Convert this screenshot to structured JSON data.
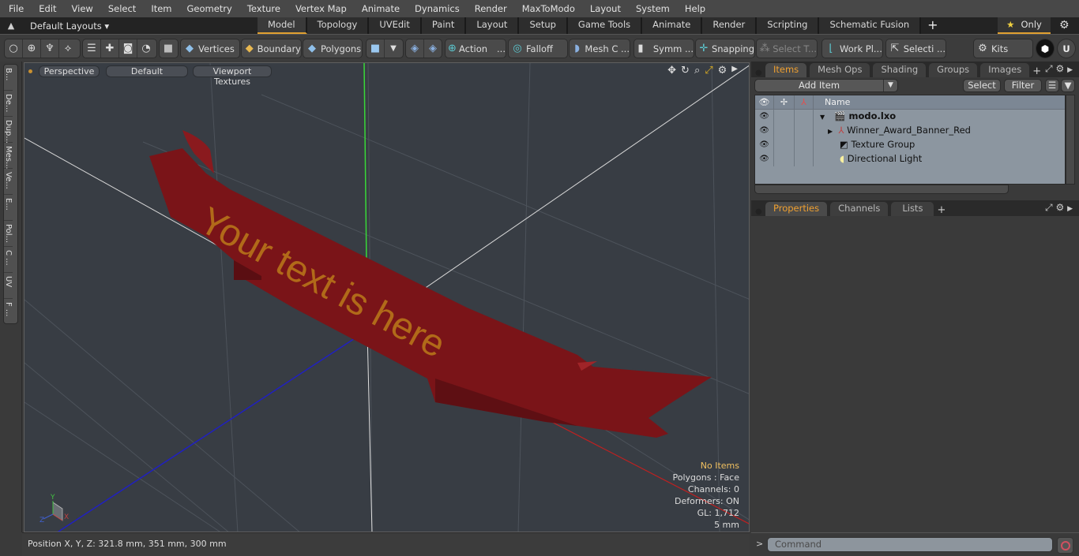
{
  "menu": [
    "File",
    "Edit",
    "View",
    "Select",
    "Item",
    "Geometry",
    "Texture",
    "Vertex Map",
    "Animate",
    "Dynamics",
    "Render",
    "MaxToModo",
    "Layout",
    "System",
    "Help"
  ],
  "layoutbar": {
    "layouts_label": "Default Layouts",
    "tabs": [
      "Model",
      "Topology",
      "UVEdit",
      "Paint",
      "Layout",
      "Setup",
      "Game Tools",
      "Animate",
      "Render",
      "Scripting",
      "Schematic Fusion"
    ],
    "active_tab": "Model",
    "only_label": "Only"
  },
  "toolbar": {
    "vertices": "Vertices",
    "boundary": "Boundary",
    "polygons": "Polygons",
    "action": "Action",
    "falloff": "Falloff",
    "mesh": "Mesh C ...",
    "symmetry": "Symm ...",
    "snapping": "Snapping",
    "select_t": "Select T...",
    "work_plane": "Work Pl...",
    "selection": "Selecti ...",
    "kits": "Kits",
    "ellipsis": "..."
  },
  "left_tabs": [
    "B...",
    "De...",
    "Dup...",
    "Mes...",
    "Ve...",
    "E...",
    "Pol...",
    "C ...",
    "UV",
    "F ..."
  ],
  "viewport": {
    "projection": "Perspective",
    "shading": "Default",
    "texture_mode": "Viewport Textures",
    "banner_text": "Your text is here",
    "colors": {
      "banner": "#7a1418",
      "banner_text": "#b8741a",
      "bg": "#383d44"
    },
    "stats": {
      "selection": "No Items",
      "polygons": "Polygons : Face",
      "channels": "Channels: 0",
      "deformers": "Deformers: ON",
      "gl": "GL: 1,712",
      "grid": "5 mm"
    },
    "axis_labels": {
      "x": "X",
      "y": "Y",
      "z": "Z"
    }
  },
  "status": {
    "position": "Position X, Y, Z:   321.8 mm, 351 mm, 300 mm"
  },
  "items_panel": {
    "tabs": [
      "Items",
      "Mesh Ops",
      "Shading",
      "Groups",
      "Images"
    ],
    "active_tab": "Items",
    "add_item": "Add Item",
    "select": "Select",
    "filter": "Filter",
    "column_name": "Name",
    "tree": [
      {
        "label": "modo.lxo",
        "bold": true,
        "depth": 0
      },
      {
        "label": "Winner_Award_Banner_Red",
        "depth": 1
      },
      {
        "label": "Texture Group",
        "depth": 1
      },
      {
        "label": "Directional Light",
        "depth": 1
      }
    ]
  },
  "properties_panel": {
    "tabs": [
      "Properties",
      "Channels",
      "Lists"
    ],
    "active_tab": "Properties"
  },
  "command": {
    "placeholder": "Command",
    "prompt": ">"
  }
}
